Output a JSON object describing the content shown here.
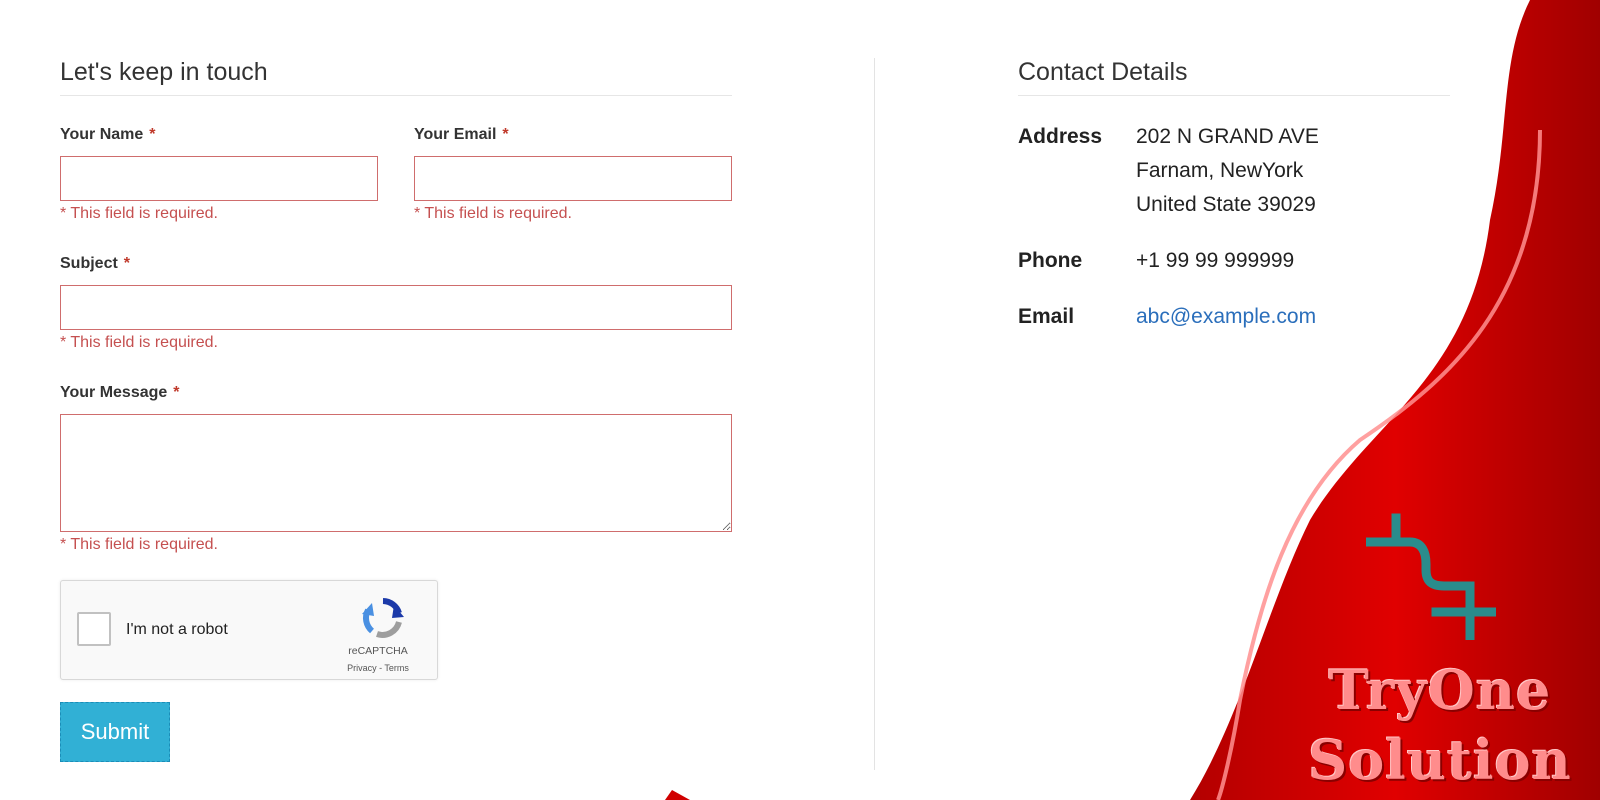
{
  "form": {
    "title": "Let's keep in touch",
    "name_label": "Your Name",
    "email_label": "Your Email",
    "subject_label": "Subject",
    "message_label": "Your Message",
    "required_mark": "*",
    "name_value": "",
    "email_value": "",
    "subject_value": "",
    "message_value": "",
    "name_error": "* This field is required.",
    "email_error": "* This field is required.",
    "subject_error": "* This field is required.",
    "message_error": "* This field is required.",
    "submit_label": "Submit"
  },
  "captcha": {
    "checkbox_label": "I'm not a robot",
    "checked": false,
    "brand": "reCAPTCHA",
    "links": "Privacy - Terms",
    "icon": "recaptcha-icon"
  },
  "contact": {
    "title": "Contact Details",
    "address_label": "Address",
    "address_line1": "202 N GRAND AVE",
    "address_line2": "Farnam, NewYork",
    "address_line3": "United State 39029",
    "phone_label": "Phone",
    "phone_value": "+1 99 99 999999",
    "email_label": "Email",
    "email_value": "abc@example.com"
  },
  "branding": {
    "line1": "TryOne",
    "line2": "Solution",
    "logo_icon": "tryone-logo-icon"
  },
  "colors": {
    "accent_red": "#c40000",
    "error_red": "#c55050",
    "submit_blue": "#31b0d5",
    "link_blue": "#2a6ebb",
    "logo_teal": "#2a8c8c"
  }
}
